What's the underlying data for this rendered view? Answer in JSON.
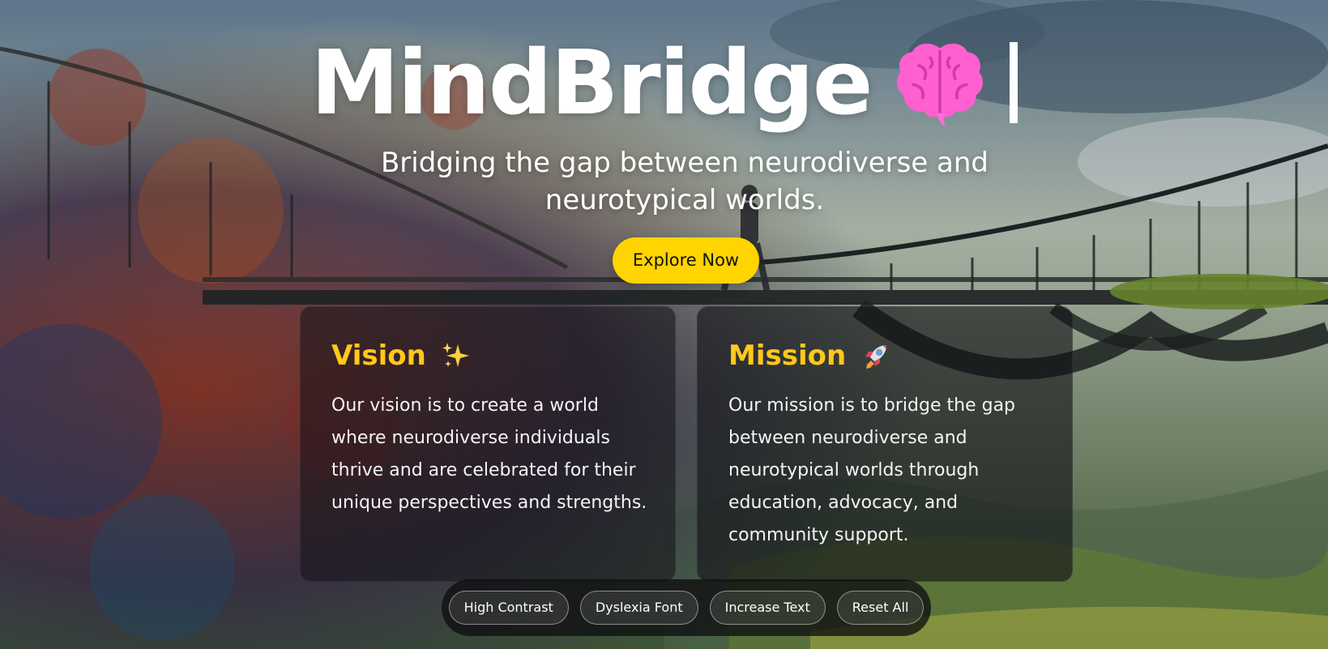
{
  "hero": {
    "title": "MindBridge",
    "title_icon": "brain-emoji-icon",
    "subtitle": "Bridging the gap between neurodiverse and neurotypical worlds.",
    "cta_label": "Explore Now"
  },
  "cards": {
    "vision": {
      "title": "Vision",
      "icon": "sparkles-icon",
      "text": "Our vision is to create a world where neurodiverse individuals thrive and are celebrated for their unique perspectives and strengths."
    },
    "mission": {
      "title": "Mission",
      "icon": "rocket-icon",
      "text": "Our mission is to bridge the gap between neurodiverse and neurotypical worlds through education, advocacy, and community support."
    }
  },
  "accessibility": {
    "high_contrast": "High Contrast",
    "dyslexia_font": "Dyslexia Font",
    "increase_text": "Increase Text",
    "reset_all": "Reset All"
  },
  "colors": {
    "accent_yellow": "#ffd400",
    "heading_yellow": "#ffc81a",
    "brain_pink": "#ff4fc8"
  }
}
